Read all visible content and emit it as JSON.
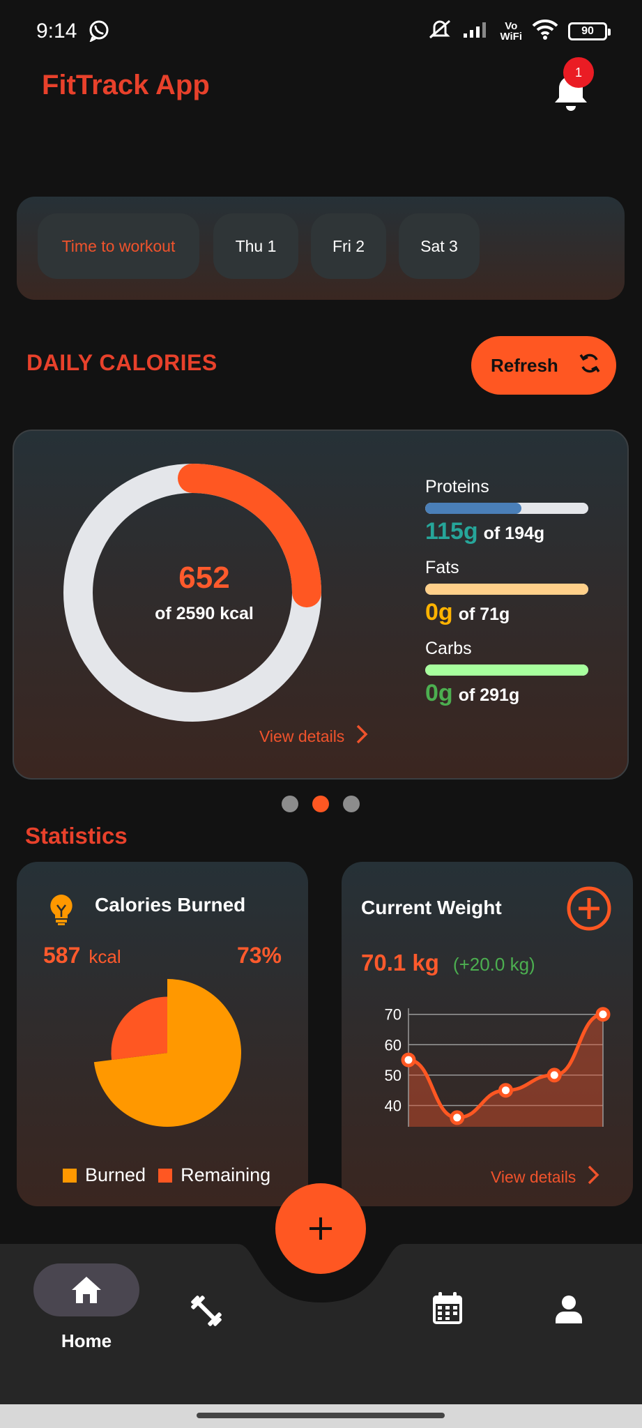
{
  "status_bar": {
    "time": "9:14",
    "volte_top": "Vo",
    "volte_bottom": "WiFi",
    "battery": "90"
  },
  "header": {
    "app_title": "FitTrack App",
    "notification_count": "1"
  },
  "day_selector": {
    "items": [
      {
        "label": "Time to workout",
        "active": true
      },
      {
        "label": "Thu 1"
      },
      {
        "label": "Fri 2"
      },
      {
        "label": "Sat 3"
      }
    ]
  },
  "daily_calories": {
    "title": "DAILY CALORIES",
    "refresh_label": "Refresh",
    "consumed": "652",
    "goal_text": "of 2590 kcal",
    "progress": 0.25,
    "view_details": "View details",
    "macros": [
      {
        "label": "Proteins",
        "amount": "115g",
        "total": "of 194g",
        "progress": 0.59,
        "fill_color": "#4a7fb8",
        "amount_color": "#26a69a"
      },
      {
        "label": "Fats",
        "amount": "0g",
        "total": "of 71g",
        "progress": 1.0,
        "fill_color": "#ffd08a",
        "amount_color": "#ffb300"
      },
      {
        "label": "Carbs",
        "amount": "0g",
        "total": "of 291g",
        "progress": 1.0,
        "fill_color": "#a8ff9e",
        "amount_color": "#4caf50"
      }
    ]
  },
  "pager": {
    "count": 3,
    "active": 1
  },
  "statistics": {
    "title": "Statistics",
    "calories_burned": {
      "title": "Calories Burned",
      "kcal_value": "587",
      "kcal_unit": "kcal",
      "percent": "73%",
      "legend_burned": "Burned",
      "legend_remaining": "Remaining",
      "burned_color": "#ff9800",
      "remaining_color": "#ff5722"
    },
    "current_weight": {
      "title": "Current Weight",
      "value": "70.1 kg",
      "delta": "(+20.0 kg)",
      "view_details": "View details"
    }
  },
  "chart_data": {
    "type": "line",
    "y_ticks": [
      "70",
      "60",
      "50",
      "40"
    ],
    "ylim": [
      33,
      72
    ],
    "values": [
      55,
      36,
      45,
      50,
      70
    ]
  },
  "bottom_nav": {
    "home_label": "Home"
  },
  "colors": {
    "accent": "#ff5722",
    "title_red": "#e8412b"
  }
}
